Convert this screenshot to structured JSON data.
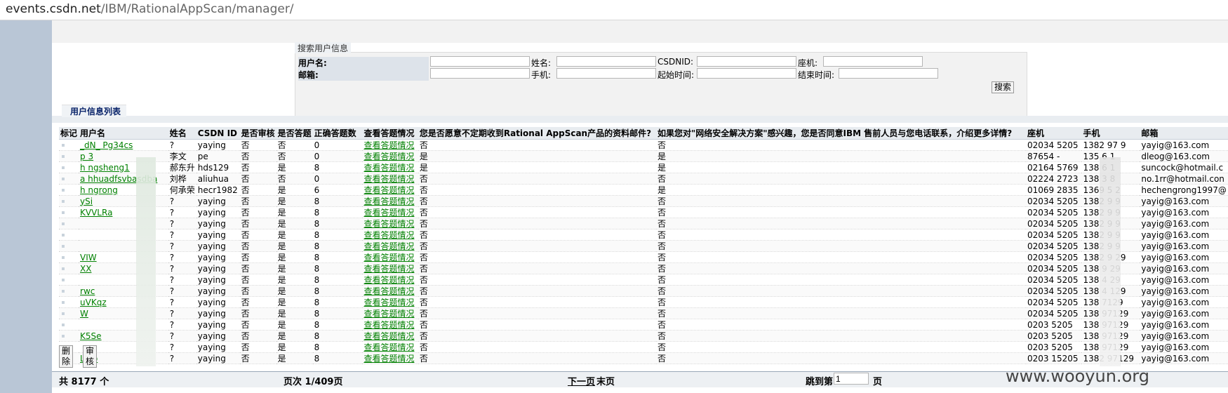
{
  "browser": {
    "url_host": "events.csdn.net",
    "url_path": "/IBM/RationalAppScan/manager/"
  },
  "search": {
    "title": "搜索用户信息",
    "labels": {
      "username": "用户名:",
      "name": "姓名:",
      "csdnid": "CSDNID:",
      "phone": "座机:",
      "email": "邮箱:",
      "mobile": "手机:",
      "start_time": "起始时间:",
      "end_time": "结束时间:"
    },
    "search_button": "搜索"
  },
  "list": {
    "title": "用户信息列表",
    "headers": [
      "标记",
      "用户名",
      "姓名",
      "CSDN ID",
      "是否审核",
      "是否答题",
      "正确答题数",
      "查看答题情况",
      "您是否愿意不定期收到Rational AppScan产品的资料邮件?",
      "如果您对\"网络安全解决方案\"感兴趣，您是否同意IBM 售前人员与您电话联系，介绍更多详情?",
      "座机",
      "手机",
      "邮箱"
    ],
    "rows": [
      {
        "user": "_dN_ Pg34cs",
        "name": "?",
        "csdn": "yaying",
        "audit": "否",
        "answered": "否",
        "correct": "0",
        "view": "查看答题情况",
        "q1": "否",
        "q2": "否",
        "phone": "02034  5205",
        "mobile": "1382  97  9",
        "email": "yayig@163.com"
      },
      {
        "user": "p  3",
        "name": "李文",
        "csdn": "pe",
        "audit": "否",
        "answered": "否",
        "correct": "0",
        "view": "查看答题情况",
        "q1": "是",
        "q2": "是",
        "phone": "87654  -",
        "mobile": "135   6  1",
        "email": "dleog@163.com"
      },
      {
        "user": "h   ngsheng1",
        "name": "郝东升",
        "csdn": "hds129",
        "audit": "否",
        "answered": "是",
        "correct": "8",
        "view": "查看答题情况",
        "q1": "是",
        "q2": "是",
        "phone": "02164  5769",
        "mobile": "138   6  1",
        "email": "suncock@hotmail.c"
      },
      {
        "user": "a  hhuadfsvbasdba",
        "name": "刘桦",
        "csdn": "aliuhua",
        "audit": "否",
        "answered": "否",
        "correct": "0",
        "view": "查看答题情况",
        "q1": "否",
        "q2": "否",
        "phone": "02224  2723",
        "mobile": "138   3  8",
        "email": "no.1rr@hotmail.con"
      },
      {
        "user": "h  ngrong",
        "name": "何承荣",
        "csdn": "hecr1982",
        "audit": "否",
        "answered": "是",
        "correct": "6",
        "view": "查看答题情况",
        "q1": "否",
        "q2": "是",
        "phone": "01069  2835",
        "mobile": "1369   5  2",
        "email": "hechengrong1997@"
      },
      {
        "user": "  ySi",
        "name": "?",
        "csdn": "yaying",
        "audit": "否",
        "answered": "是",
        "correct": "8",
        "view": "查看答题情况",
        "q1": "否",
        "q2": "否",
        "phone": "02034  5205",
        "mobile": "1382   9  9",
        "email": "yayig@163.com"
      },
      {
        "user": "  KVVLRa",
        "name": "?",
        "csdn": "yaying",
        "audit": "否",
        "answered": "是",
        "correct": "8",
        "view": "查看答题情况",
        "q1": "否",
        "q2": "否",
        "phone": "02034  5205",
        "mobile": "1382   9  9",
        "email": "yayig@163.com"
      },
      {
        "user": "",
        "name": "?",
        "csdn": "yaying",
        "audit": "否",
        "answered": "是",
        "correct": "8",
        "view": "查看答题情况",
        "q1": "否",
        "q2": "否",
        "phone": "02034  5205",
        "mobile": "1382   9  9",
        "email": "yayig@163.com"
      },
      {
        "user": "",
        "name": "?",
        "csdn": "yaying",
        "audit": "否",
        "answered": "是",
        "correct": "8",
        "view": "查看答题情况",
        "q1": "否",
        "q2": "否",
        "phone": "02034  5205",
        "mobile": "1382   9  9",
        "email": "yayig@163.com"
      },
      {
        "user": "",
        "name": "?",
        "csdn": "yaying",
        "audit": "否",
        "answered": "是",
        "correct": "8",
        "view": "查看答题情况",
        "q1": "否",
        "q2": "否",
        "phone": "02034  5205",
        "mobile": "1382   9  9",
        "email": "yayig@163.com"
      },
      {
        "user": "  VIW",
        "name": "?",
        "csdn": "yaying",
        "audit": "否",
        "answered": "是",
        "correct": "8",
        "view": "查看答题情况",
        "q1": "否",
        "q2": "否",
        "phone": "02034  5205",
        "mobile": "1382   9  29",
        "email": "yayig@163.com"
      },
      {
        "user": "  XX",
        "name": "?",
        "csdn": "yaying",
        "audit": "否",
        "answered": "是",
        "correct": "8",
        "view": "查看答题情况",
        "q1": "否",
        "q2": "否",
        "phone": "02034  5205",
        "mobile": "138   9  29",
        "email": "yayig@163.com"
      },
      {
        "user": "",
        "name": "?",
        "csdn": "yaying",
        "audit": "否",
        "answered": "是",
        "correct": "8",
        "view": "查看答题情况",
        "q1": "否",
        "q2": "否",
        "phone": "02034  5205",
        "mobile": "138   4  29",
        "email": "yayig@163.com"
      },
      {
        "user": "  rwc",
        "name": "?",
        "csdn": "yaying",
        "audit": "否",
        "answered": "是",
        "correct": "8",
        "view": "查看答题情况",
        "q1": "否",
        "q2": "否",
        "phone": "02034  5205",
        "mobile": "138   4  129",
        "email": "yayig@163.com"
      },
      {
        "user": "  uVKqz",
        "name": "?",
        "csdn": "yaying",
        "audit": "否",
        "answered": "是",
        "correct": "8",
        "view": "查看答题情况",
        "q1": "否",
        "q2": "否",
        "phone": "02034  5205",
        "mobile": "138   7129",
        "email": "yayig@163.com"
      },
      {
        "user": "  W",
        "name": "?",
        "csdn": "yaying",
        "audit": "否",
        "answered": "是",
        "correct": "8",
        "view": "查看答题情况",
        "q1": "否",
        "q2": "否",
        "phone": "02034  5205",
        "mobile": "138   97129",
        "email": "yayig@163.com"
      },
      {
        "user": "",
        "name": "?",
        "csdn": "yaying",
        "audit": "否",
        "answered": "是",
        "correct": "8",
        "view": "查看答题情况",
        "q1": "否",
        "q2": "否",
        "phone": "0203   5205",
        "mobile": "138   97129",
        "email": "yayig@163.com"
      },
      {
        "user": "  K5Se",
        "name": "?",
        "csdn": "yaying",
        "audit": "否",
        "answered": "是",
        "correct": "8",
        "view": "查看答题情况",
        "q1": "否",
        "q2": "否",
        "phone": "0203   5205",
        "mobile": "138   97129",
        "email": "yayig@163.com"
      },
      {
        "user": "",
        "name": "?",
        "csdn": "yaying",
        "audit": "否",
        "answered": "是",
        "correct": "8",
        "view": "查看答题情况",
        "q1": "否",
        "q2": "否",
        "phone": "0203   5205",
        "mobile": "138   97129",
        "email": "yayig@163.com"
      },
      {
        "user": "  L3ib",
        "name": "?",
        "csdn": "yaying",
        "audit": "否",
        "answered": "是",
        "correct": "8",
        "view": "查看答题情况",
        "q1": "否",
        "q2": "否",
        "phone": "0203  15205",
        "mobile": "1382  97129",
        "email": "yayig@163.com"
      }
    ],
    "delete_button": "删除",
    "audit_button": "审核"
  },
  "footer": {
    "total": "共 8177 个",
    "page": "页次 1/409页",
    "next": "下一页",
    "last": "末页",
    "jump_label": "跳到第",
    "jump_value": "1",
    "jump_suffix": "页"
  },
  "watermark": "www.wooyun.org"
}
